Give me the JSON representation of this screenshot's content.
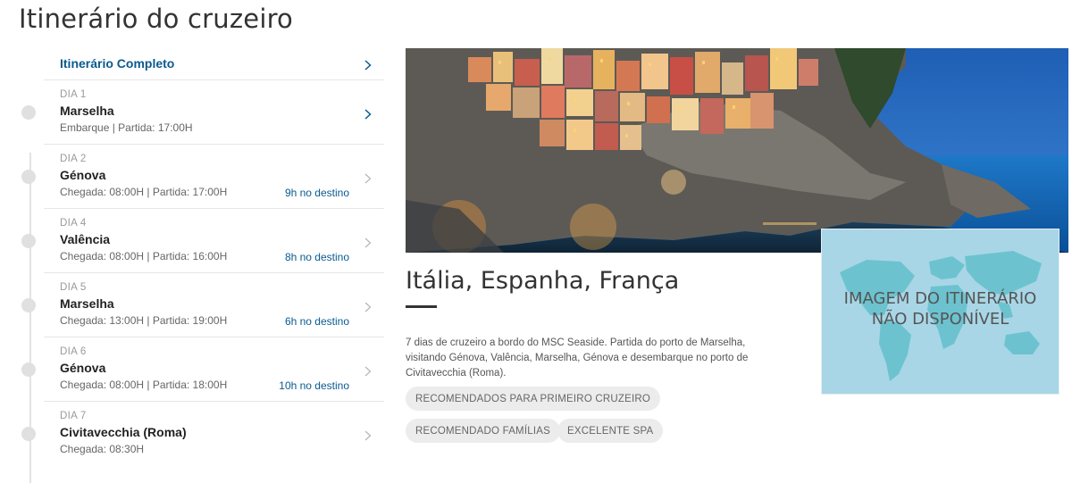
{
  "page": {
    "title": "Itinerário do cruzeiro"
  },
  "itinerary": {
    "full_label": "Itinerário Completo",
    "days": [
      {
        "day": "DIA 1",
        "port": "Marselha",
        "times": "Embarque | Partida: 17:00H",
        "dest": ""
      },
      {
        "day": "DIA 2",
        "port": "Génova",
        "times": "Chegada: 08:00H | Partida: 17:00H",
        "dest": "9h no destino"
      },
      {
        "day": "DIA 4",
        "port": "Valência",
        "times": "Chegada: 08:00H | Partida: 16:00H",
        "dest": "8h no destino"
      },
      {
        "day": "DIA 5",
        "port": "Marselha",
        "times": "Chegada: 13:00H | Partida: 19:00H",
        "dest": "6h no destino"
      },
      {
        "day": "DIA 6",
        "port": "Génova",
        "times": "Chegada: 08:00H | Partida: 18:00H",
        "dest": "10h no destino"
      },
      {
        "day": "DIA 7",
        "port": "Civitavecchia (Roma)",
        "times": "Chegada: 08:30H",
        "dest": ""
      }
    ]
  },
  "destination": {
    "title": "Itália, Espanha, França",
    "description": "7 dias de cruzeiro a bordo do MSC Seaside. Partida do porto de Marselha, visitando Génova, Valência, Marselha, Génova e desembarque no porto de Civitavecchia (Roma).",
    "tags": [
      "RECOMENDADOS PARA PRIMEIRO CRUZEIRO",
      "RECOMENDADO FAMÍLIAS",
      "EXCELENTE SPA"
    ]
  },
  "map": {
    "line1": "IMAGEM DO ITINERÁRIO",
    "line2": "NÃO DISPONÍVEL"
  },
  "icons": {
    "chevron": "chevron-right-icon"
  },
  "colors": {
    "accent_blue": "#0a5a8f",
    "map_bg": "#a8d6e6",
    "tag_bg": "#ececec"
  }
}
